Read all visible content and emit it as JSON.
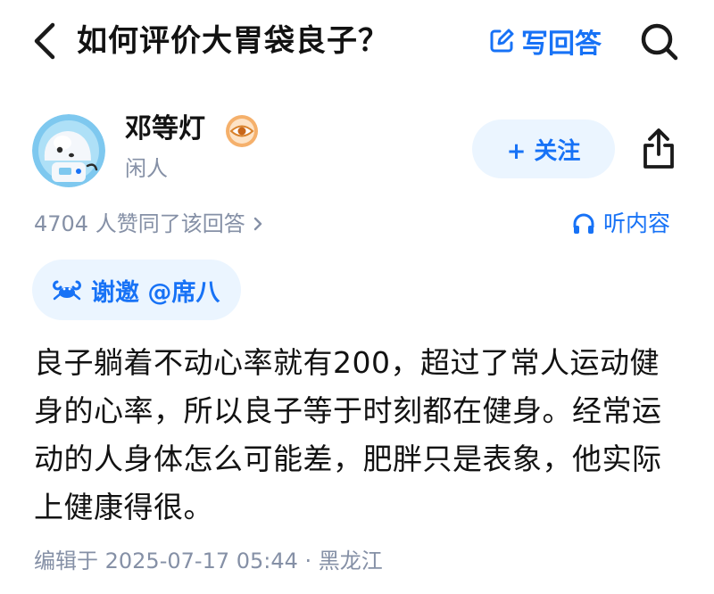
{
  "header": {
    "title": "如何评价大胃袋良子？",
    "write_answer_label": "写回答",
    "icons": {
      "back": "chevron-left-icon",
      "write": "edit-icon",
      "search": "search-icon"
    }
  },
  "author": {
    "name": "邓等灯",
    "bio": "闲人",
    "follow_label": "+ 关注",
    "badge_icon": "eye-badge-icon",
    "avatar_icon": "astronaut-avatar"
  },
  "meta": {
    "likes_text": "4704 人赞同了该回答",
    "listen_label": "听内容"
  },
  "invite": {
    "label": "谢邀 @席八",
    "icon": "crab-icon"
  },
  "answer": {
    "text": "良子躺着不动心率就有200，超过了常人运动健身的心率，所以良子等于时刻都在健身。经常运动的人身体怎么可能差，肥胖只是表象，他实际上健康得很。"
  },
  "footer": {
    "edited": "编辑于 2025-07-17 05:44 · 黑龙江"
  },
  "colors": {
    "accent": "#1772f6",
    "accent_bg": "#ebf5ff",
    "secondary_text": "#8590a6",
    "primary_text": "#121212"
  }
}
